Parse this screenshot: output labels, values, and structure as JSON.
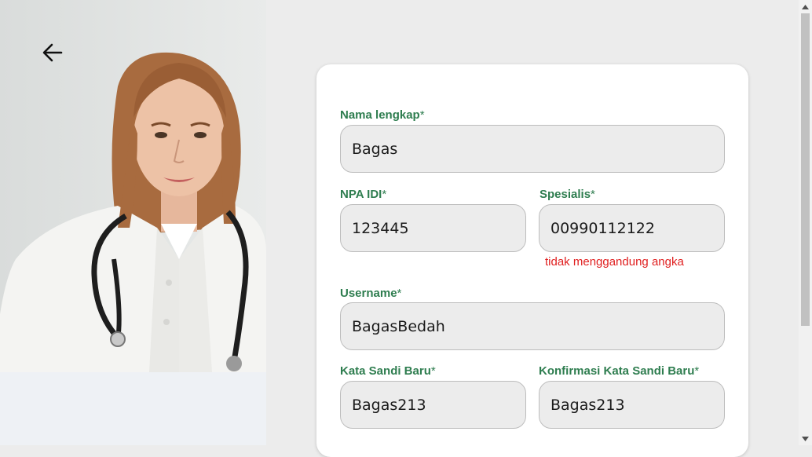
{
  "icons": {
    "back": "arrow-left-icon",
    "scroll_up": "triangle-up-icon",
    "scroll_down": "triangle-down-icon"
  },
  "colors": {
    "label": "#2e7d4f",
    "error": "#e02020",
    "input_bg": "#ececec",
    "card_bg": "#ffffff"
  },
  "photo": {
    "alt": "Doctor with stethoscope"
  },
  "form": {
    "full_name": {
      "label": "Nama lengkap",
      "required_mark": "*",
      "value": "Bagas"
    },
    "npa_idi": {
      "label": "NPA IDI",
      "required_mark": "*",
      "value": "123445"
    },
    "specialist": {
      "label": "Spesialis",
      "required_mark": "*",
      "value": "00990112122",
      "error": "tidak menggandung angka"
    },
    "username": {
      "label": "Username",
      "required_mark": "*",
      "value": "BagasBedah"
    },
    "new_password": {
      "label": "Kata Sandi Baru",
      "required_mark": "*",
      "value": "Bagas213"
    },
    "confirm_password": {
      "label": "Konfirmasi Kata Sandi Baru",
      "required_mark": "*",
      "value": "Bagas213"
    }
  }
}
